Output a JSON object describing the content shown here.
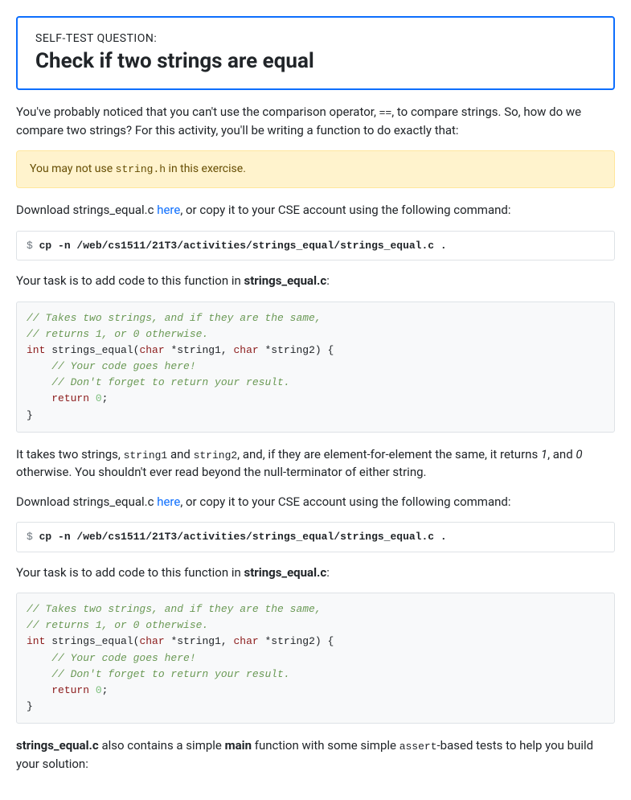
{
  "card": {
    "label": "SELF-TEST QUESTION:",
    "title": "Check if two strings are equal"
  },
  "intro": {
    "part1": "You've probably noticed that you can't use the comparison operator, ",
    "op": "==",
    "part2": ", to compare strings. So, how do we compare two strings? For this activity, you'll be writing a function to do exactly that:"
  },
  "warning": {
    "pre": "You may not use ",
    "code": "string.h",
    "post": " in this exercise."
  },
  "download": {
    "pre": "Download strings_equal.c ",
    "link": "here",
    "post": ", or copy it to your CSE account using the following command:"
  },
  "cmd": {
    "prompt": "$ ",
    "text": "cp -n /web/cs1511/21T3/activities/strings_equal/strings_equal.c ."
  },
  "task": {
    "pre": "Your task is to add code to this function in ",
    "file": "strings_equal.c",
    "post": ":"
  },
  "code": {
    "c1": "// Takes two strings, and if they are the same,",
    "c2": "// returns 1, or 0 otherwise.",
    "kw_int": "int",
    "fn": " strings_equal(",
    "kw_char1": "char",
    "arg1": " *string1, ",
    "kw_char2": "char",
    "arg2": " *string2) {",
    "c3": "    // Your code goes here!",
    "c4": "    // Don't forget to return your result.",
    "indent": "    ",
    "kw_return": "return",
    "space": " ",
    "zero": "0",
    "semi": ";",
    "close": "}"
  },
  "desc": {
    "p1": "It takes two strings, ",
    "s1": "string1",
    "p2": " and ",
    "s2": "string2",
    "p3": ", and, if they are element-for-element the same, it returns ",
    "one": "1",
    "p4": ", and ",
    "zero": "0",
    "p5": " otherwise. You shouldn't ever read beyond the null-terminator of either string."
  },
  "footer": {
    "file": "strings_equal.c",
    "p1": " also contains a simple ",
    "main": "main",
    "p2": " function with some simple ",
    "assert": "assert",
    "p3": "-based tests to help you build your solution:"
  }
}
